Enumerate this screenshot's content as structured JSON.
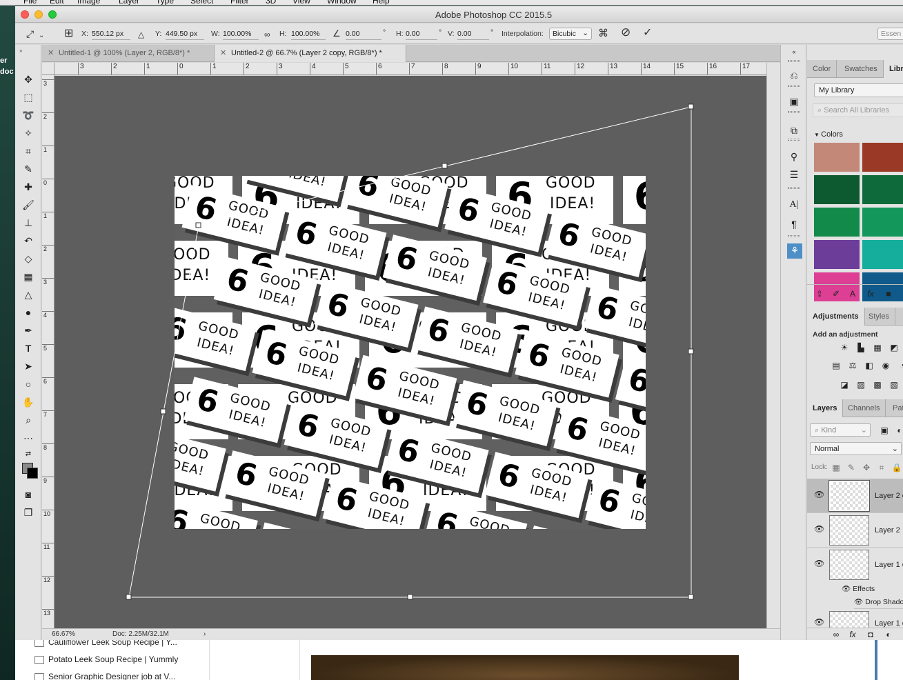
{
  "menubar": {
    "items": [
      "File",
      "Edit",
      "Image",
      "Layer",
      "Type",
      "Select",
      "Filter",
      "3D",
      "View",
      "Window",
      "Help"
    ]
  },
  "desktop": {
    "left_text_1": "er",
    "left_text_2": "doc"
  },
  "background_browser": {
    "bookmarks": [
      "Cauliflower Leek Soup Recipe | Y...",
      "Potato Leek Soup Recipe | Yummly",
      "Senior Graphic Designer job at V..."
    ]
  },
  "window": {
    "title": "Adobe Photoshop CC 2015.5"
  },
  "options": {
    "x_label": "X:",
    "x_value": "550.12 px",
    "y_label": "Y:",
    "y_value": "449.50 px",
    "w_label": "W:",
    "w_value": "100.00%",
    "h_label": "H:",
    "h_value": "100.00%",
    "angle_value": "0.00",
    "angle_unit": "°",
    "hskew_label": "H:",
    "hskew_value": "0.00",
    "hskew_unit": "°",
    "vskew_label": "V:",
    "vskew_value": "0.00",
    "vskew_unit": "°",
    "interp_label": "Interpolation:",
    "interp_value": "Bicubic",
    "workspace": "Essen"
  },
  "tabs": [
    {
      "label": "Untitled-1 @ 100% (Layer 2, RGB/8*) *"
    },
    {
      "label": "Untitled-2 @ 66.7% (Layer 2 copy, RGB/8*) *"
    }
  ],
  "ruler": {
    "h_labels": [
      "3",
      "2",
      "1",
      "0",
      "1",
      "2",
      "3",
      "4",
      "5",
      "6",
      "7",
      "8",
      "9",
      "10",
      "11",
      "12",
      "13",
      "14",
      "15",
      "16",
      "17"
    ],
    "v_labels": [
      "3",
      "2",
      "1",
      "0",
      "1",
      "2",
      "3",
      "4",
      "5",
      "6",
      "7",
      "8",
      "9",
      "10",
      "11",
      "12",
      "13"
    ]
  },
  "artwork": {
    "swirl": "6",
    "line1": "GOOD",
    "line2": "IDEA!"
  },
  "status": {
    "zoom": "66.67%",
    "doc": "Doc: 2.25M/32.1M"
  },
  "panels": {
    "color_tabs": [
      "Color",
      "Swatches",
      "Libr"
    ],
    "library_select": "My Library",
    "library_search_placeholder": "Search All Libraries",
    "colors_header": "Colors",
    "colors": [
      "#c48878",
      "#9a3a26",
      "#0e5a30",
      "#0e6a3a",
      "#128a4a",
      "#13975a",
      "#6c3d99",
      "#15ad9c",
      "#dc3f93",
      "#0f5a8a"
    ],
    "adj_tabs": [
      "Adjustments",
      "Styles"
    ],
    "add_adjustment": "Add an adjustment",
    "layers_tabs": [
      "Layers",
      "Channels",
      "Pat"
    ],
    "kind_placeholder": "Kind",
    "blend_mode": "Normal",
    "lock_label": "Lock:",
    "layers": [
      {
        "name": "Layer 2 c"
      },
      {
        "name": "Layer 2"
      },
      {
        "name": "Layer 1 c"
      },
      {
        "name": "Layer 1 c"
      }
    ],
    "effects_label": "Effects",
    "drop_shadow_label": "Drop Shado"
  }
}
